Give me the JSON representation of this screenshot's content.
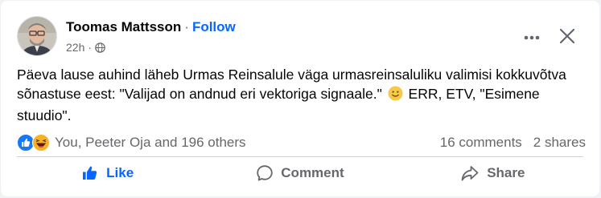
{
  "post": {
    "author": "Toomas Mattsson",
    "separator": "·",
    "follow_label": "Follow",
    "timestamp": "22h",
    "meta_separator": "·",
    "audience_icon": "globe-icon",
    "text_part1": "Päeva lause auhind läheb Urmas Reinsalule väga urmasreinsaluliku valimisi kokkuvõtva sõnastuse eest: \"Valijad on andnud eri vektoriga signaale.\"",
    "emoji": "slightly-smiling-face-emoji",
    "text_part2": "ERR, ETV, \"Esimene stuudio\"."
  },
  "reactions": {
    "icons": [
      "like-reaction-icon",
      "haha-reaction-icon"
    ],
    "summary": "You, Peeter Oja and 196 others",
    "comments": "16 comments",
    "shares": "2 shares"
  },
  "actions": {
    "like_label": "Like",
    "comment_label": "Comment",
    "share_label": "Share"
  },
  "colors": {
    "accent": "#0866ff",
    "secondary_text": "#65676b",
    "primary_text": "#050505",
    "divider": "#ced0d4"
  }
}
